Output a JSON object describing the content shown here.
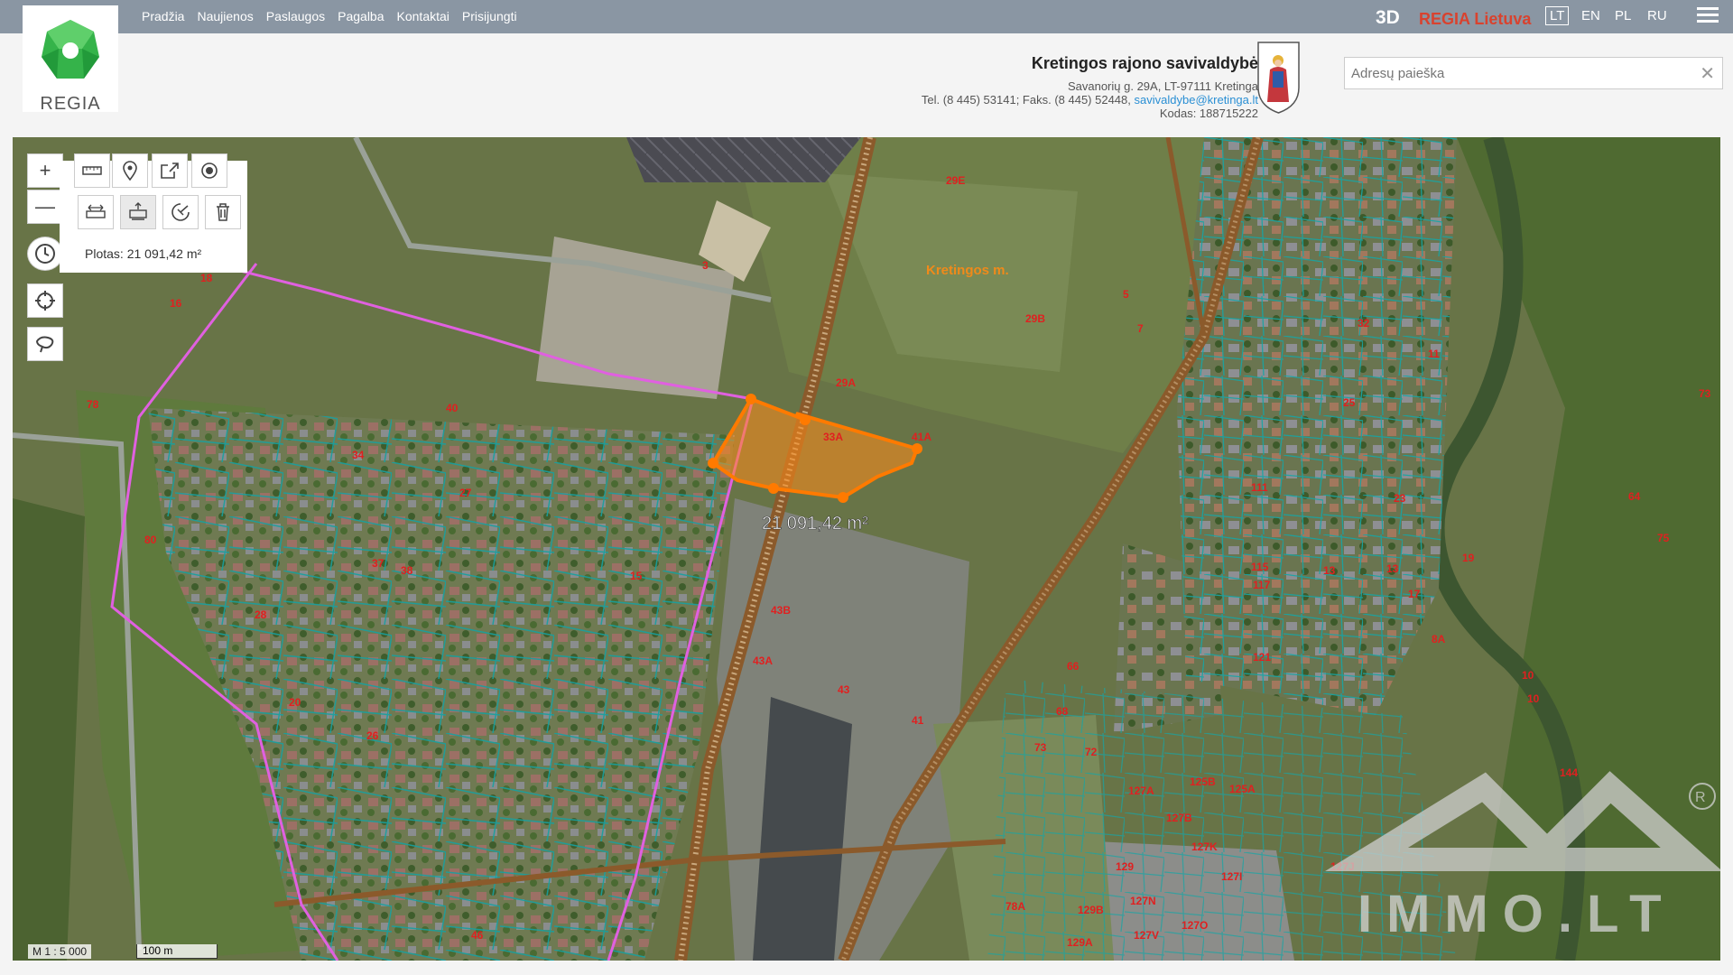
{
  "nav": [
    "Pradžia",
    "Naujienos",
    "Paslaugos",
    "Pagalba",
    "Kontaktai",
    "Prisijungti"
  ],
  "logo": "REGIA",
  "btn_3d": "3D",
  "regia_lietuva": "REGIA Lietuva",
  "languages": [
    "LT",
    "EN",
    "PL",
    "RU"
  ],
  "municipality": {
    "title": "Kretingos rajono savivaldybė",
    "address": "Savanorių g. 29A, LT-97111 Kretinga",
    "phones": "Tel. (8 445) 53141; Faks. (8 445) 52448,",
    "email": "savivaldybe@kretinga.lt",
    "code": "Kodas: 188715222"
  },
  "search": {
    "placeholder": "Adresų paieška",
    "clear": "✕"
  },
  "tools": {
    "zoom_in": "+",
    "zoom_out": "—",
    "area_readout": "Plotas: 21 091,42 m²"
  },
  "map": {
    "measured_area_label": "21 091,42 m²",
    "town_label": "Kretingos m.",
    "scale": "M 1 : 5 000",
    "scale_bar": "100 m",
    "watermark": "IMMO.LT",
    "parcel_labels": [
      {
        "t": "29E"
      },
      {
        "t": "29B"
      },
      {
        "t": "29A"
      },
      {
        "t": "33A"
      },
      {
        "t": "41A"
      },
      {
        "t": "43B"
      },
      {
        "t": "43A"
      },
      {
        "t": "43"
      },
      {
        "t": "41"
      },
      {
        "t": "66"
      },
      {
        "t": "68"
      },
      {
        "t": "73"
      },
      {
        "t": "72"
      },
      {
        "t": "111"
      },
      {
        "t": "115"
      },
      {
        "t": "117"
      },
      {
        "t": "121"
      },
      {
        "t": "127A"
      },
      {
        "t": "127B"
      },
      {
        "t": "127K"
      },
      {
        "t": "127I"
      },
      {
        "t": "127N"
      },
      {
        "t": "127V"
      },
      {
        "t": "127O"
      },
      {
        "t": "127J"
      },
      {
        "t": "125A"
      },
      {
        "t": "125B"
      },
      {
        "t": "129"
      },
      {
        "t": "129B"
      },
      {
        "t": "129A"
      },
      {
        "t": "78A"
      },
      {
        "t": "80"
      },
      {
        "t": "78"
      },
      {
        "t": "18"
      },
      {
        "t": "16"
      },
      {
        "t": "40"
      },
      {
        "t": "34"
      },
      {
        "t": "27"
      },
      {
        "t": "37"
      },
      {
        "t": "38"
      },
      {
        "t": "28"
      },
      {
        "t": "20"
      },
      {
        "t": "26"
      },
      {
        "t": "46"
      },
      {
        "t": "15"
      },
      {
        "t": "10"
      },
      {
        "t": "64"
      },
      {
        "t": "75"
      },
      {
        "t": "73"
      },
      {
        "t": "19"
      },
      {
        "t": "8A"
      },
      {
        "t": "10"
      },
      {
        "t": "144"
      },
      {
        "t": "23"
      },
      {
        "t": "25"
      },
      {
        "t": "32"
      },
      {
        "t": "11"
      },
      {
        "t": "13"
      },
      {
        "t": "17"
      },
      {
        "t": "13"
      },
      {
        "t": "3"
      },
      {
        "t": "5"
      },
      {
        "t": "7"
      }
    ]
  },
  "colors": {
    "topbar": "#8a96a3",
    "measured_area": "#ff8c1a",
    "parcel_line": "#1aa3a3",
    "label_red": "#e02020",
    "municipal_boundary": "#e060e0"
  }
}
